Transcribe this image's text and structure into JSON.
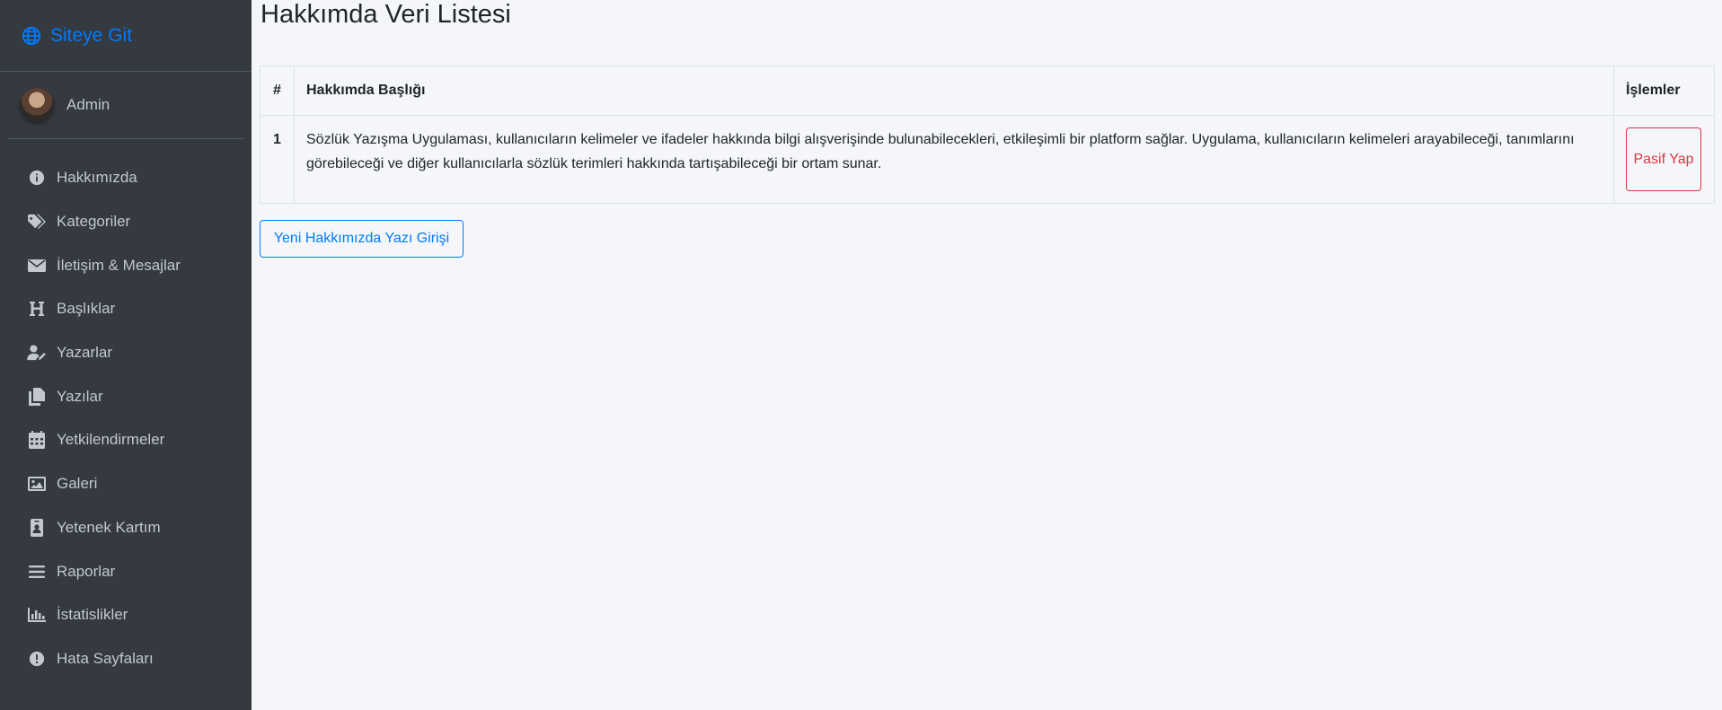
{
  "brand": {
    "label": "Siteye Git",
    "icon": "globe-icon",
    "color": "#007bff"
  },
  "user": {
    "name": "Admin"
  },
  "sidebar": {
    "items": [
      {
        "label": "Hakkımızda",
        "icon": "info-circle-icon"
      },
      {
        "label": "Kategoriler",
        "icon": "tags-icon"
      },
      {
        "label": "İletişim & Mesajlar",
        "icon": "envelope-icon"
      },
      {
        "label": "Başlıklar",
        "icon": "heading-icon"
      },
      {
        "label": "Yazarlar",
        "icon": "user-edit-icon"
      },
      {
        "label": "Yazılar",
        "icon": "copy-icon"
      },
      {
        "label": "Yetkilendirmeler",
        "icon": "calendar-icon"
      },
      {
        "label": "Galeri",
        "icon": "image-icon"
      },
      {
        "label": "Yetenek Kartım",
        "icon": "id-badge-icon"
      },
      {
        "label": "Raporlar",
        "icon": "bars-icon"
      },
      {
        "label": "İstatislikler",
        "icon": "chart-bar-icon"
      },
      {
        "label": "Hata Sayfaları",
        "icon": "exclamation-circle-icon"
      }
    ]
  },
  "main": {
    "title": "Hakkımda Veri Listesi",
    "table": {
      "headers": {
        "num": "#",
        "title": "Hakkımda Başlığı",
        "ops": "İşlemler"
      },
      "rows": [
        {
          "num": "1",
          "text": "Sözlük Yazışma Uygulaması, kullanıcıların kelimeler ve ifadeler hakkında bilgi alışverişinde bulunabilecekleri, etkileşimli bir platform sağlar. Uygulama, kullanıcıların kelimeleri arayabileceği, tanımlarını görebileceği ve diğer kullanıcılarla sözlük terimleri hakkında tartışabileceği bir ortam sunar.",
          "action": "Pasif Yap"
        }
      ]
    },
    "new_button": "Yeni Hakkımızda Yazı Girişi"
  },
  "colors": {
    "sidebar_bg": "#343a40",
    "content_bg": "#f4f6f9",
    "danger": "#dc3545",
    "primary": "#007bff"
  }
}
